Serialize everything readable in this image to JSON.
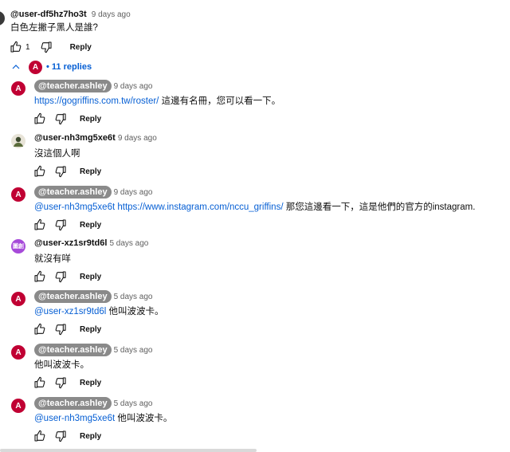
{
  "comment": {
    "author": "@user-df5hz7ho3t",
    "time": "9 days ago",
    "text": "白色左撇子黑人是誰?",
    "likes": "1",
    "reply_label": "Reply"
  },
  "replies_toggle": {
    "avatar_letter": "A",
    "label": "• 11 replies"
  },
  "replies": [
    {
      "avatar_letter": "A",
      "avatar_color": "#c00033",
      "author": "@teacher.ashley",
      "badge": true,
      "time": "9 days ago",
      "parts": [
        {
          "t": "https://gogriffins.com.tw/roster/",
          "link": true
        },
        {
          "t": " 這邊有名冊，您可以看一下。",
          "link": false
        }
      ]
    },
    {
      "avatar_letter": "",
      "avatar_color": "#3d4a2f",
      "author": "@user-nh3mg5xe6t",
      "badge": false,
      "time": "9 days ago",
      "parts": [
        {
          "t": "沒這個人啊",
          "link": false
        }
      ]
    },
    {
      "avatar_letter": "A",
      "avatar_color": "#c00033",
      "author": "@teacher.ashley",
      "badge": true,
      "time": "9 days ago",
      "parts": [
        {
          "t": " @user-nh3mg5xe6t ",
          "link": true
        },
        {
          "t": " ",
          "link": false
        },
        {
          "t": "https://www.instagram.com/nccu_griffins/",
          "link": true
        },
        {
          "t": " 那您這邊看一下，這是他們的官方的instagram.",
          "link": false
        }
      ]
    },
    {
      "avatar_letter": "圖創",
      "avatar_color": "#a64ad9",
      "author": "@user-xz1sr9td6l",
      "badge": false,
      "time": "5 days ago",
      "parts": [
        {
          "t": "就沒有咩",
          "link": false
        }
      ]
    },
    {
      "avatar_letter": "A",
      "avatar_color": "#c00033",
      "author": "@teacher.ashley",
      "badge": true,
      "time": "5 days ago",
      "parts": [
        {
          "t": " @user-xz1sr9td6l ",
          "link": true
        },
        {
          "t": " 他叫波波卡。",
          "link": false
        }
      ]
    },
    {
      "avatar_letter": "A",
      "avatar_color": "#c00033",
      "author": "@teacher.ashley",
      "badge": true,
      "time": "5 days ago",
      "parts": [
        {
          "t": "他叫波波卡。",
          "link": false
        }
      ]
    },
    {
      "avatar_letter": "A",
      "avatar_color": "#c00033",
      "author": "@teacher.ashley",
      "badge": true,
      "time": "5 days ago",
      "parts": [
        {
          "t": " @user-nh3mg5xe6t ",
          "link": true
        },
        {
          "t": " 他叫波波卡。",
          "link": false
        }
      ]
    }
  ],
  "reply_label": "Reply"
}
